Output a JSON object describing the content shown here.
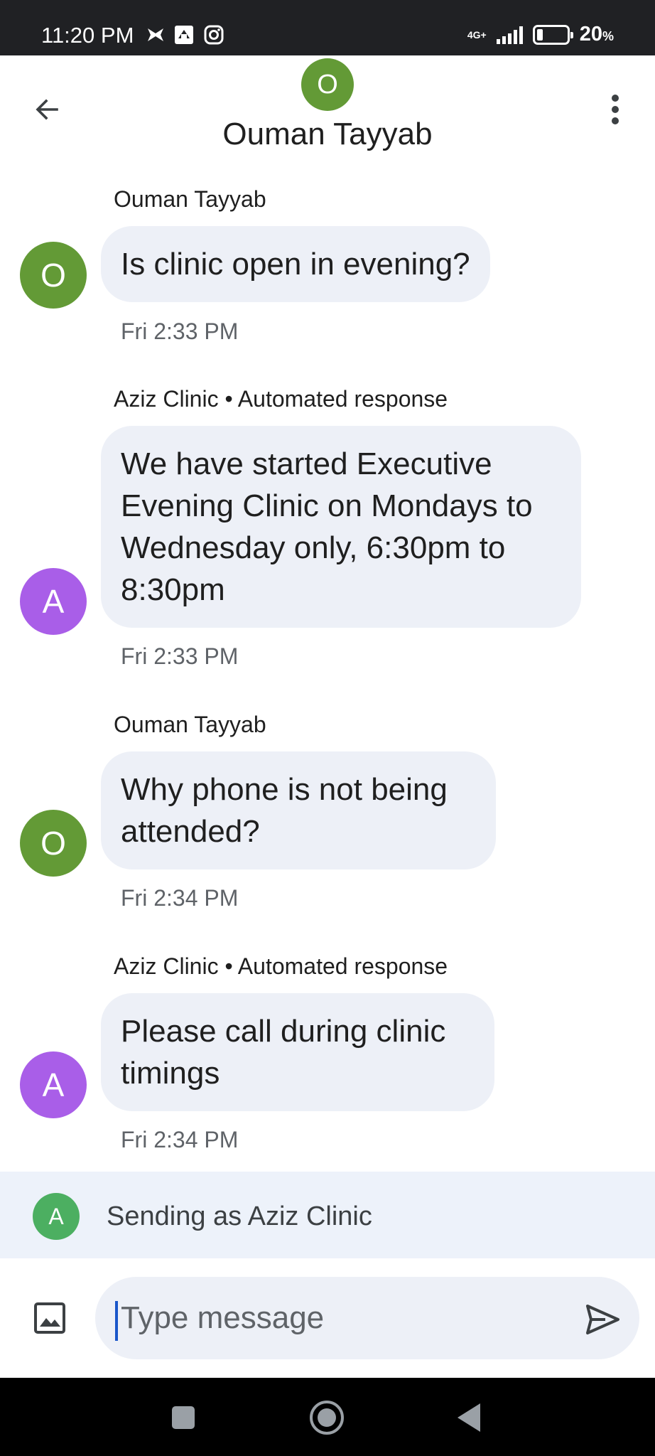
{
  "status_bar": {
    "time": "11:20 PM",
    "notification_icons": [
      "pinwheel-icon",
      "bars-app-icon",
      "instagram-icon"
    ],
    "network_type": "4G+",
    "battery_level_percent": 20,
    "battery_label": "20",
    "battery_unit": "%"
  },
  "header": {
    "avatar_letter": "O",
    "contact_name": "Ouman Tayyab",
    "back_icon": "arrow-back-icon",
    "menu_icon": "more-vert-icon",
    "avatar_color": "#639a36"
  },
  "messages": [
    {
      "sender": "Ouman Tayyab",
      "avatar_letter": "O",
      "text": "Is clinic open in evening?",
      "time": "Fri 2:33 PM"
    },
    {
      "sender": "Aziz Clinic • Automated response",
      "avatar_letter": "A",
      "text": "We have started Executive Evening Clinic on Mondays to Wednesday only, 6:30pm to 8:30pm",
      "time": "Fri 2:33 PM"
    },
    {
      "sender": "Ouman Tayyab",
      "avatar_letter": "O",
      "text": "Why phone is not being attended?",
      "time": "Fri 2:34 PM"
    },
    {
      "sender": "Aziz Clinic • Automated response",
      "avatar_letter": "A",
      "text": "Please call during clinic timings",
      "time": "Fri 2:34 PM"
    }
  ],
  "sending_as": {
    "avatar_letter": "A",
    "label": "Sending as Aziz Clinic",
    "avatar_color": "#4caf61"
  },
  "compose": {
    "placeholder": "Type message",
    "value": "",
    "gallery_icon": "image-icon",
    "send_icon": "send-icon"
  },
  "nav_bar": {
    "buttons": [
      "recents-square-icon",
      "home-circle-icon",
      "back-triangle-icon"
    ]
  },
  "colors": {
    "bubble": "#edf0f7",
    "avatar_o": "#639a36",
    "avatar_a": "#a95ee8",
    "sending_bar": "#edf2fa",
    "caret": "#1a56c9"
  }
}
